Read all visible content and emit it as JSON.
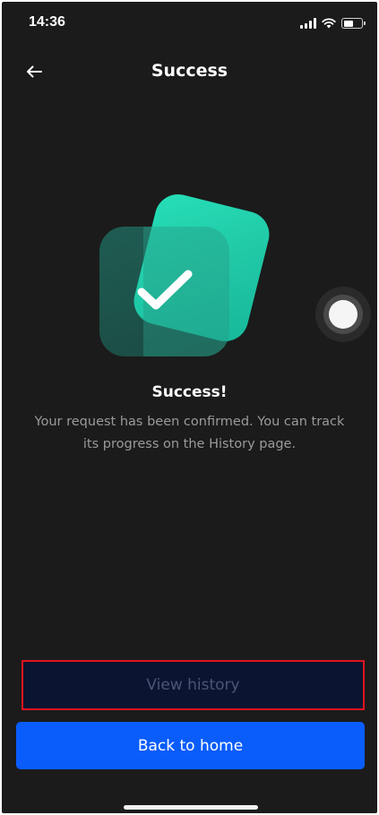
{
  "status_bar": {
    "time": "14:36",
    "icons": [
      "signal-icon",
      "wifi-icon",
      "battery-icon"
    ]
  },
  "header": {
    "title": "Success",
    "back_icon": "arrow-left-icon"
  },
  "illustration": {
    "icon": "check-icon",
    "colors": {
      "accent": "#27f0c6",
      "back_card": "#1f5c52"
    }
  },
  "content": {
    "heading": "Success!",
    "message": "Your request has been confirmed. You can track its progress on the History page."
  },
  "actions": {
    "view_history_label": "View history",
    "back_home_label": "Back to home"
  },
  "colors": {
    "background": "#1b1b1b",
    "primary": "#0a5dfb",
    "secondary_bg": "#0b1430",
    "highlight_border": "#e0141e"
  }
}
